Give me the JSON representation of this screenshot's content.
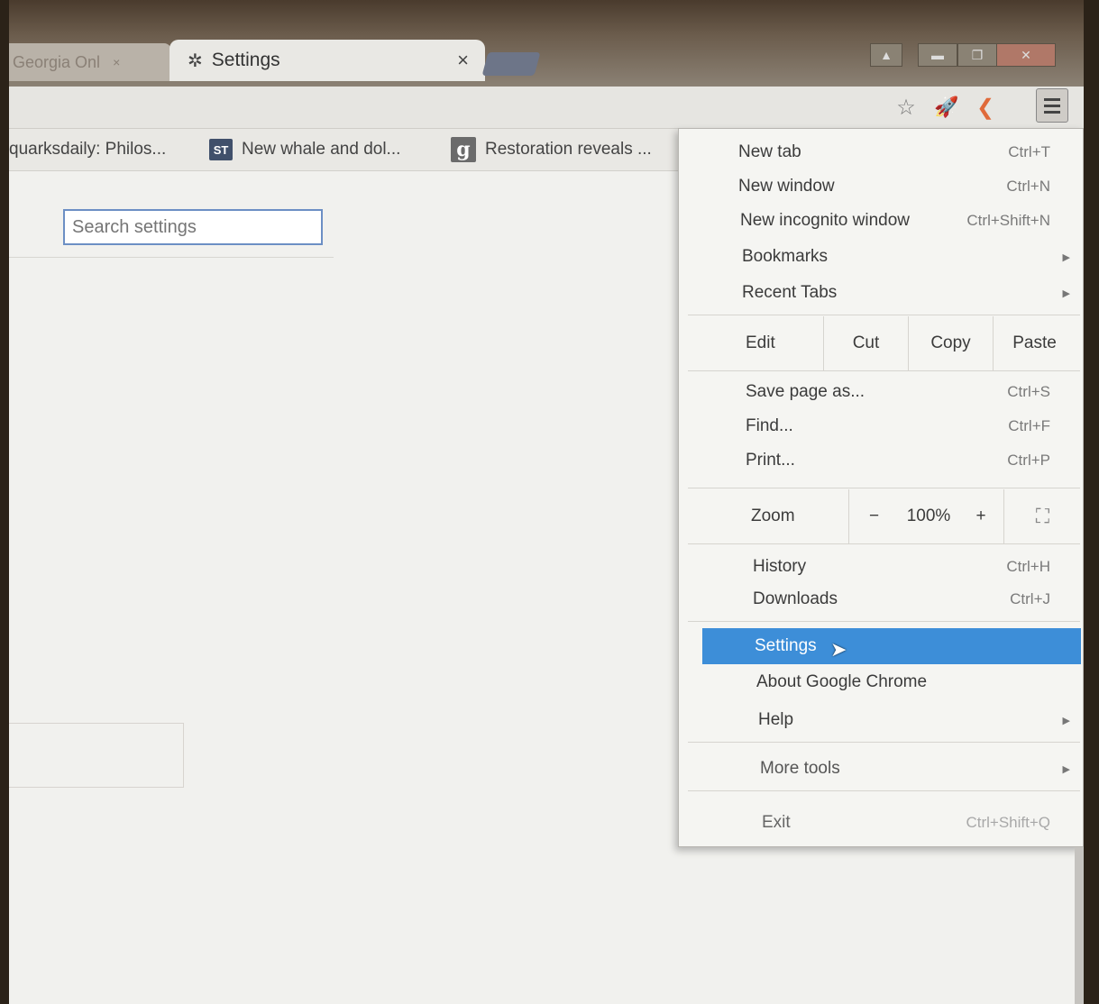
{
  "tabs": [
    {
      "label": "Georgia Onl",
      "close": "×"
    },
    {
      "label": "Settings",
      "close": "×"
    }
  ],
  "bookmarks": [
    {
      "label": "quarksdaily: Philos...",
      "favicon": ""
    },
    {
      "label": "New whale and dol...",
      "favicon": "ST"
    },
    {
      "label": "Restoration reveals ...",
      "favicon": "g"
    }
  ],
  "search": {
    "placeholder": "Search settings"
  },
  "menu": {
    "top_items": [
      {
        "label": "New tab",
        "shortcut": "Ctrl+T"
      },
      {
        "label": "New window",
        "shortcut": "Ctrl+N"
      },
      {
        "label": "New incognito window",
        "shortcut": "Ctrl+Shift+N"
      },
      {
        "label": "Bookmarks",
        "shortcut": ""
      },
      {
        "label": "Recent Tabs",
        "shortcut": ""
      }
    ],
    "edit": {
      "label": "Edit",
      "cut": "Cut",
      "copy": "Copy",
      "paste": "Paste"
    },
    "page_items": [
      {
        "label": "Save page as...",
        "shortcut": "Ctrl+S"
      },
      {
        "label": "Find...",
        "shortcut": "Ctrl+F"
      },
      {
        "label": "Print...",
        "shortcut": "Ctrl+P"
      }
    ],
    "zoom": {
      "label": "Zoom",
      "minus": "−",
      "value": "100%",
      "plus": "+"
    },
    "history_items": [
      {
        "label": "History",
        "shortcut": "Ctrl+H"
      },
      {
        "label": "Downloads",
        "shortcut": "Ctrl+J"
      }
    ],
    "settings_label": "Settings",
    "about_label": "About Google Chrome",
    "help_label": "Help",
    "more_tools_label": "More tools",
    "exit": {
      "label": "Exit",
      "shortcut": "Ctrl+Shift+Q"
    }
  },
  "icons": {
    "tab_settings": "gear-icon",
    "toolbar": [
      "star-icon",
      "rocket-icon",
      "bird-icon",
      "menu-icon"
    ]
  },
  "colors": {
    "highlight": "#3d8ed8",
    "search_border": "#6c8fc4"
  }
}
